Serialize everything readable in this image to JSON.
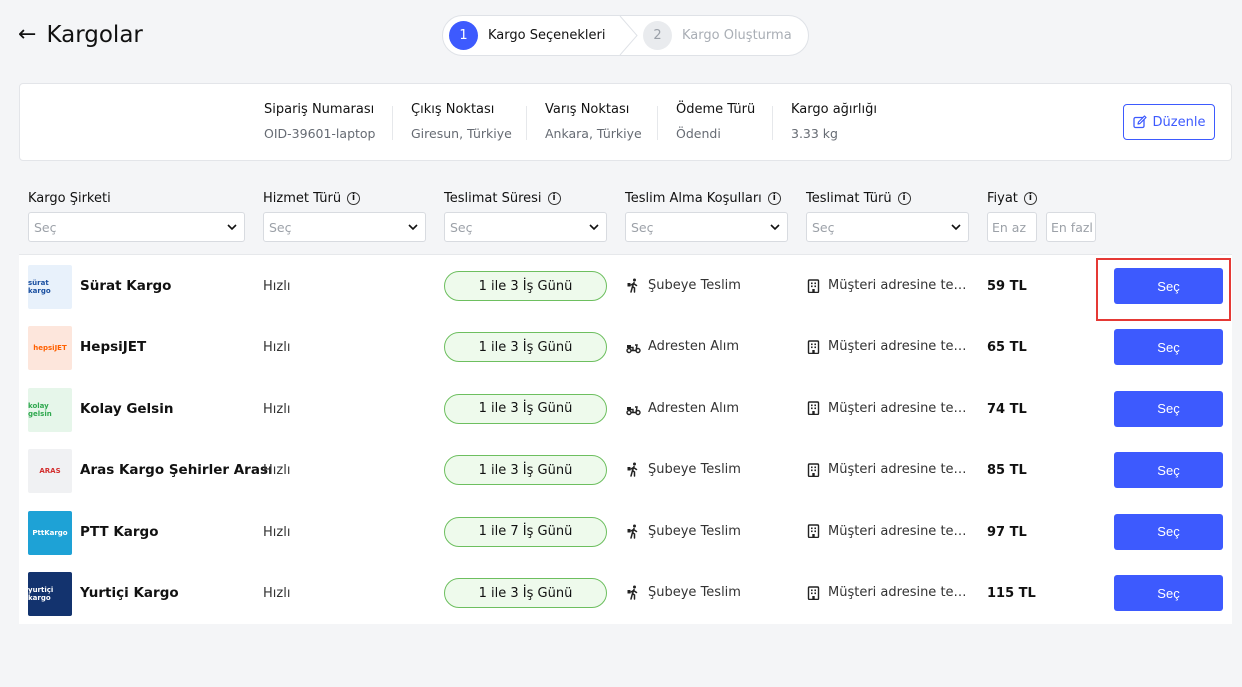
{
  "header": {
    "back_icon": "arrow-left-icon",
    "title": "Kargolar"
  },
  "stepper": {
    "steps": [
      {
        "num": "1",
        "label": "Kargo Seçenekleri",
        "active": true
      },
      {
        "num": "2",
        "label": "Kargo Oluşturma",
        "active": false
      }
    ]
  },
  "order_info": {
    "fields": [
      {
        "label": "Sipariş Numarası",
        "value": "OID-39601-laptop"
      },
      {
        "label": "Çıkış Noktası",
        "value": "Giresun, Türkiye"
      },
      {
        "label": "Varış Noktası",
        "value": "Ankara, Türkiye"
      },
      {
        "label": "Ödeme Türü",
        "value": "Ödendi"
      },
      {
        "label": "Kargo ağırlığı",
        "value": "3.33 kg"
      }
    ],
    "edit_label": "Düzenle"
  },
  "table": {
    "headers": {
      "company": "Kargo Şirketi",
      "service": "Hizmet Türü",
      "duration": "Teslimat Süresi",
      "pickup": "Teslim Alma Koşulları",
      "delivery": "Teslimat Türü",
      "price": "Fiyat"
    },
    "filter_placeholder": "Seç",
    "price_min_placeholder": "En az",
    "price_max_placeholder": "En fazl",
    "rows": [
      {
        "logo_text": "sürat kargo",
        "logo_bg": "#e8f1fb",
        "logo_color": "#1a4fa0",
        "name": "Sürat Kargo",
        "service": "Hızlı",
        "duration": "1 ile 3 İş Günü",
        "pickup": "Şubeye Teslim",
        "pickup_icon": "walking-person-icon",
        "delivery": "Müşteri adresine teslim",
        "price": "59 TL",
        "button": "Seç"
      },
      {
        "logo_text": "hepsiJET",
        "logo_bg": "#fde6dc",
        "logo_color": "#ff6000",
        "name": "HepsiJET",
        "service": "Hızlı",
        "duration": "1 ile 3 İş Günü",
        "pickup": "Adresten Alım",
        "pickup_icon": "scooter-icon",
        "delivery": "Müşteri adresine teslim",
        "price": "65 TL",
        "button": "Seç"
      },
      {
        "logo_text": "kolay gelsin",
        "logo_bg": "#e6f6ea",
        "logo_color": "#2fa84f",
        "name": "Kolay Gelsin",
        "service": "Hızlı",
        "duration": "1 ile 3 İş Günü",
        "pickup": "Adresten Alım",
        "pickup_icon": "scooter-icon",
        "delivery": "Müşteri adresine teslim",
        "price": "74 TL",
        "button": "Seç"
      },
      {
        "logo_text": "ARAS",
        "logo_bg": "#f0f1f3",
        "logo_color": "#d32f2f",
        "name": "Aras Kargo Şehirler Arası",
        "service": "Hızlı",
        "duration": "1 ile 3 İş Günü",
        "pickup": "Şubeye Teslim",
        "pickup_icon": "walking-person-icon",
        "delivery": "Müşteri adresine teslim",
        "price": "85 TL",
        "button": "Seç"
      },
      {
        "logo_text": "PttKargo",
        "logo_bg": "#1ea2d6",
        "logo_color": "#ffffff",
        "name": "PTT Kargo",
        "service": "Hızlı",
        "duration": "1 ile 7 İş Günü",
        "pickup": "Şubeye Teslim",
        "pickup_icon": "walking-person-icon",
        "delivery": "Müşteri adresine teslim",
        "price": "97 TL",
        "button": "Seç"
      },
      {
        "logo_text": "yurtiçi kargo",
        "logo_bg": "#13336e",
        "logo_color": "#ffffff",
        "name": "Yurtiçi Kargo",
        "service": "Hızlı",
        "duration": "1 ile 3 İş Günü",
        "pickup": "Şubeye Teslim",
        "pickup_icon": "walking-person-icon",
        "delivery": "Müşteri adresine teslim",
        "price": "115 TL",
        "button": "Seç"
      }
    ]
  },
  "colors": {
    "accent": "#3d5afe",
    "pill_bg": "#eefaec",
    "pill_border": "#6dbf5f",
    "highlight": "#e53935"
  }
}
